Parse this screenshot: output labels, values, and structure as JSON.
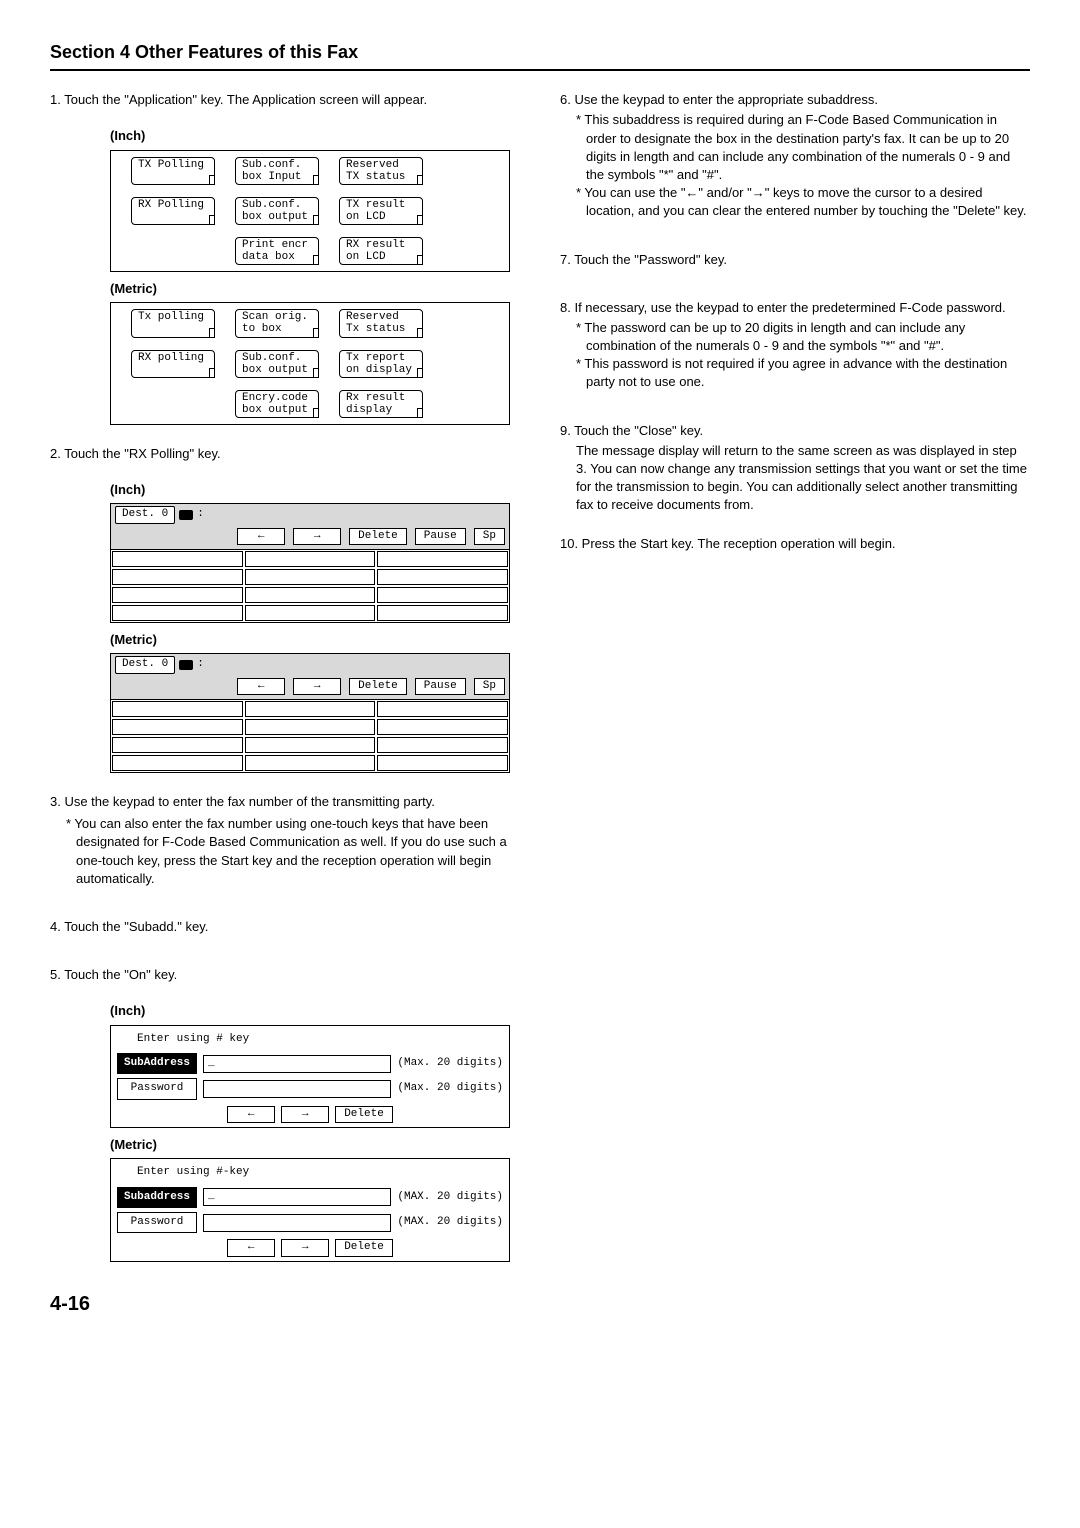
{
  "section_title": "Section 4 Other Features of this Fax",
  "page_number": "4-16",
  "left": {
    "step1": "1. Touch the \"Application\" key. The Application screen will appear.",
    "unit_inch": "(Inch)",
    "unit_metric": "(Metric)",
    "panel_inch": {
      "r1": [
        "TX Polling",
        "Sub.conf.\nbox Input",
        "Reserved\nTX status"
      ],
      "r2": [
        "RX Polling",
        "Sub.conf.\nbox output",
        "TX result\non LCD"
      ],
      "r3": [
        "",
        "Print encr\ndata box",
        "RX result\non LCD"
      ]
    },
    "panel_metric": {
      "r1": [
        "Tx polling",
        "Scan orig.\nto box",
        "Reserved\nTx status"
      ],
      "r2": [
        "RX polling",
        "Sub.conf.\nbox output",
        "Tx report\non display"
      ],
      "r3": [
        "",
        "Encry.code\nbox output",
        "Rx result\ndisplay"
      ]
    },
    "step2": "2. Touch the \"RX Polling\" key.",
    "lcd": {
      "dest": "Dest. 0",
      "btn_left": "←",
      "btn_right": "→",
      "btn_delete": "Delete",
      "btn_pause": "Pause",
      "btn_sp": "Sp"
    },
    "step3_main": "3. Use the keypad to enter the fax number of the transmitting party.",
    "step3_sub": "* You can also enter the fax number using one-touch keys that have been designated for F-Code Based Communication as well. If you do use such a one-touch key, press the Start key and the reception operation will begin automatically.",
    "step4": "4. Touch the \"Subadd.\" key.",
    "step5": "5. Touch the \"On\" key.",
    "entry_inch": {
      "title": "Enter using # key",
      "sub_label": "SubAddress",
      "pass_label": "Password",
      "note": "(Max. 20 digits)",
      "btn_left": "←",
      "btn_right": "→",
      "btn_delete": "Delete"
    },
    "entry_metric": {
      "title": "Enter using #-key",
      "sub_label": "Subaddress",
      "pass_label": "Password",
      "note": "(MAX. 20 digits)",
      "btn_left": "←",
      "btn_right": "→",
      "btn_delete": "Delete"
    }
  },
  "right": {
    "step6_main": "6. Use the keypad to enter the appropriate subaddress.",
    "step6_sub1": "* This subaddress is required during an F-Code Based Communication in order to designate the box in the destination party's fax. It can be up to 20 digits in length and can include any combination of the numerals 0 - 9 and the symbols \"*\" and \"#\".",
    "step6_sub2": "* You can use the \"←\" and/or \"→\" keys to move the cursor to a desired location, and you can clear the entered number by touching the \"Delete\" key.",
    "step7": "7. Touch the \"Password\" key.",
    "step8_main": "8. If necessary, use the keypad to enter the predetermined F-Code password.",
    "step8_sub1": "* The password can be up to 20 digits in length and can include any combination of the numerals 0 - 9 and the symbols \"*\" and \"#\".",
    "step8_sub2": "* This password is not required if you agree in advance with the destination party not to use one.",
    "step9_main": "9. Touch the \"Close\" key.",
    "step9_body": "The message display will return to the same screen as was displayed in step 3. You can now change any transmission settings that you want or set the time for the transmission to begin. You can additionally select another transmitting fax to receive documents from.",
    "step10": "10. Press the Start key. The reception operation will begin."
  }
}
